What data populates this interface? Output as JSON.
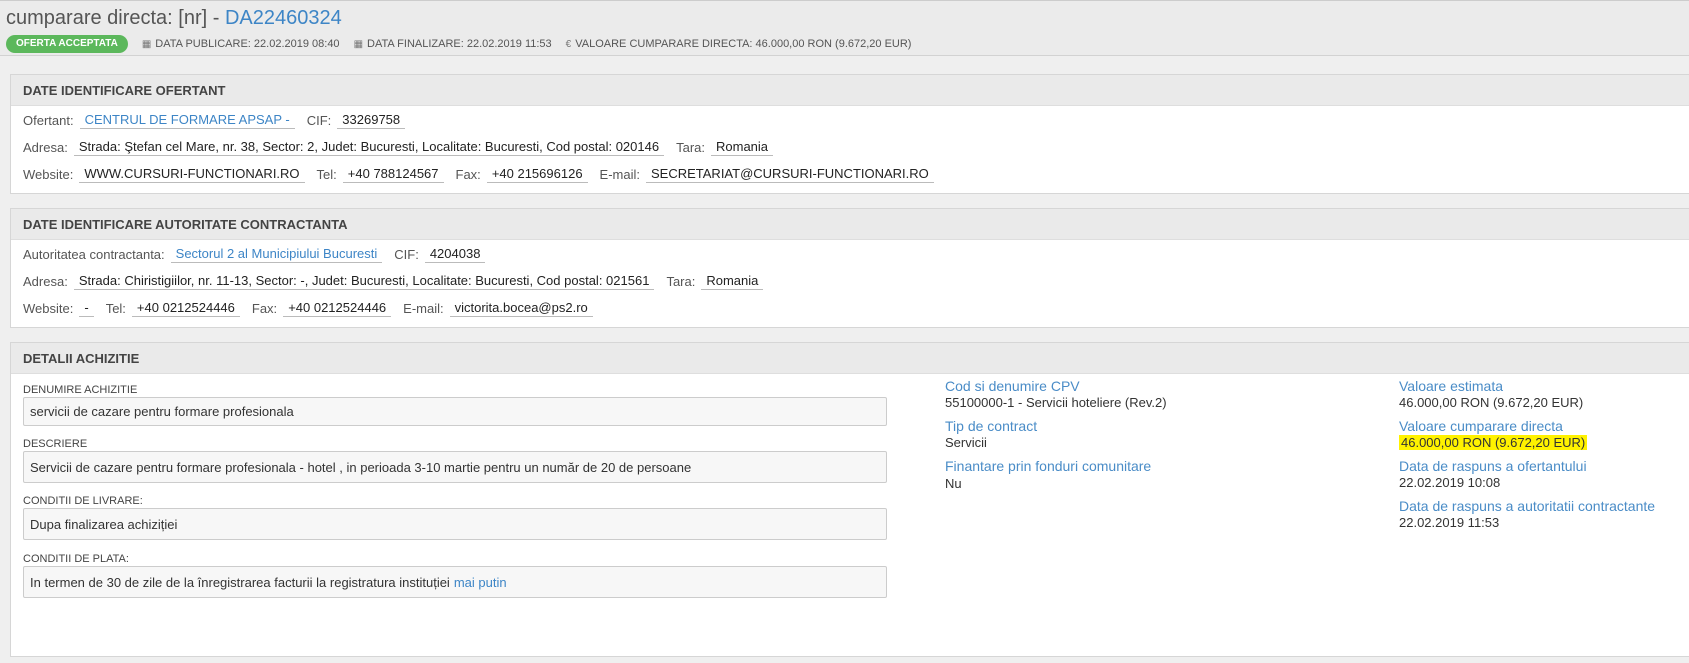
{
  "header": {
    "title_prefix": "cumparare directa: [nr] - ",
    "title_id": "DA22460324",
    "status_badge": "OFERTA ACCEPTATA",
    "date_publicare": "DATA PUBLICARE: 22.02.2019 08:40",
    "date_finalizare": "DATA FINALIZARE: 22.02.2019 11:53",
    "valoare": "VALOARE CUMPARARE DIRECTA: 46.000,00  RON (9.672,20  EUR)",
    "icons": {
      "calendar": "calendar-icon",
      "euro": "euro-icon"
    }
  },
  "ofertant": {
    "title": "DATE IDENTIFICARE OFERTANT",
    "ofertant_label": "Ofertant:",
    "ofertant_value": "CENTRUL DE FORMARE APSAP -",
    "cif_label": "CIF:",
    "cif_value": "33269758",
    "adresa_label": "Adresa:",
    "adresa_value": "Strada: Ştefan cel Mare, nr. 38, Sector: 2, Judet: Bucuresti, Localitate: Bucuresti, Cod postal: 020146",
    "tara_label": "Tara:",
    "tara_value": "Romania",
    "website_label": "Website:",
    "website_value": "WWW.CURSURI-FUNCTIONARI.RO",
    "tel_label": "Tel:",
    "tel_value": "+40 788124567",
    "fax_label": "Fax:",
    "fax_value": "+40 215696126",
    "email_label": "E-mail:",
    "email_value": "SECRETARIAT@CURSURI-FUNCTIONARI.RO"
  },
  "autoritate": {
    "title": "DATE IDENTIFICARE AUTORITATE CONTRACTANTA",
    "autoritate_label": "Autoritatea contractanta:",
    "autoritate_value": "Sectorul 2 al Municipiului Bucuresti",
    "cif_label": "CIF:",
    "cif_value": "4204038",
    "adresa_label": "Adresa:",
    "adresa_value": "Strada: Chiristigiilor, nr. 11-13, Sector: -, Judet: Bucuresti, Localitate: Bucuresti, Cod postal: 021561",
    "tara_label": "Tara:",
    "tara_value": "Romania",
    "website_label": "Website:",
    "website_value": "-",
    "tel_label": "Tel:",
    "tel_value": "+40 0212524446",
    "fax_label": "Fax:",
    "fax_value": "+40 0212524446",
    "email_label": "E-mail:",
    "email_value": "victorita.bocea@ps2.ro"
  },
  "detalii": {
    "title": "DETALII ACHIZITIE",
    "denumire_label": "DENUMIRE ACHIZITIE",
    "denumire_value": "servicii de cazare pentru formare profesionala",
    "descriere_label": "DESCRIERE",
    "descriere_value": "Servicii de cazare pentru formare profesionala - hotel , in perioada 3-10 martie pentru un număr de 20 de persoane",
    "livrare_label": "CONDITII DE LIVRARE:",
    "livrare_value": "Dupa finalizarea achiziției",
    "plata_label": "CONDITII DE PLATA:",
    "plata_value": "In termen de 30 de zile de la înregistrarea facturii la registratura instituției",
    "plata_link": "mai putin",
    "cpv_title": "Cod si denumire CPV",
    "cpv_value": "55100000-1 - Servicii hoteliere (Rev.2)",
    "tip_title": "Tip de contract",
    "tip_value": "Servicii",
    "finantare_title": "Finantare prin fonduri comunitare",
    "finantare_value": "Nu",
    "estimata_title": "Valoare estimata",
    "estimata_value": "46.000,00  RON (9.672,20  EUR)",
    "cumparare_title": "Valoare cumparare directa",
    "cumparare_value": "46.000,00  RON (9.672,20  EUR)",
    "raspuns_ofertant_title": "Data de raspuns a ofertantului",
    "raspuns_ofertant_value": "22.02.2019 10:08",
    "raspuns_autoritate_title": "Data de raspuns a autoritatii contractante",
    "raspuns_autoritate_value": "22.02.2019 11:53"
  },
  "colors": {
    "accent": "#3d85c6",
    "badge": "#5cb85c",
    "highlight": "#fff200"
  }
}
